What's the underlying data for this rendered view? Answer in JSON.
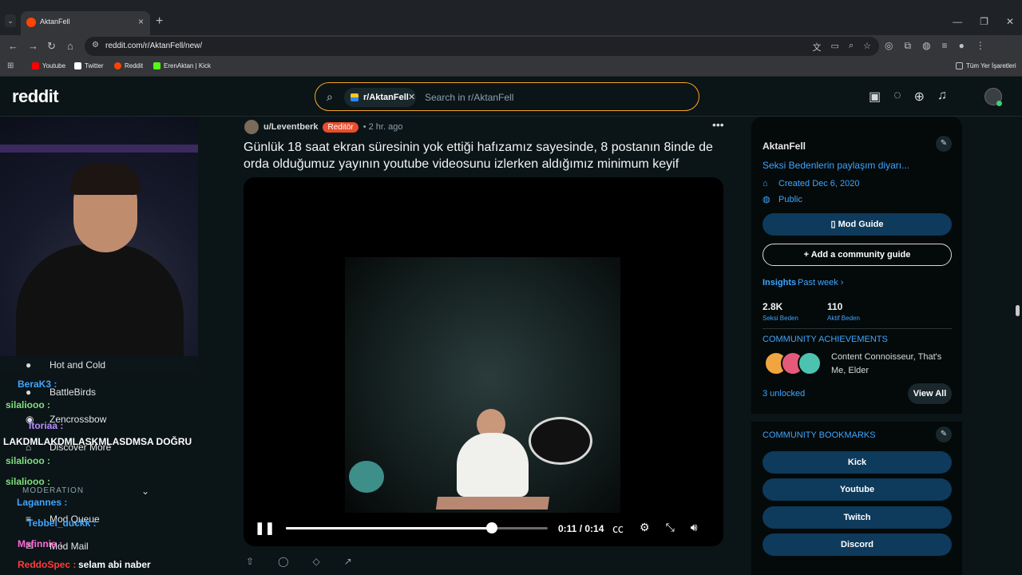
{
  "browser": {
    "tab_title": "AktanFell",
    "url": "reddit.com/r/AktanFell/new/",
    "bookmarks": [
      {
        "label": "Youtube",
        "color": "#ff0000"
      },
      {
        "label": "Twitter",
        "color": "#ffffff"
      },
      {
        "label": "Reddit",
        "color": "#ff4500"
      },
      {
        "label": "ErenAktan | Kick",
        "color": "#53fc18"
      }
    ],
    "all_bookmarks": "Tüm Yer İşaretleri"
  },
  "header": {
    "logo": "reddit",
    "search_chip": "r/AktanFell",
    "search_placeholder": "Search in r/AktanFell"
  },
  "overlay": {
    "menu": [
      "Hot and Cold",
      "BattleBirds",
      "Zencrossbow",
      "Discover More",
      "MODERATION",
      "Mod Queue",
      "Mod Mail"
    ],
    "chat": [
      {
        "user": "BeraK3 :",
        "msg": "",
        "color": "#3ea6ff"
      },
      {
        "user": "silaliooo :",
        "msg": "",
        "color": "#7fe07f"
      },
      {
        "user": "Itoriaa :",
        "msg": "",
        "color": "#b88cff"
      },
      {
        "user": "",
        "msg": "LAKDMLAKDMLASKMLASDMSA DOĞRU",
        "color": "#ffffff"
      },
      {
        "user": "silaliooo :",
        "msg": "",
        "color": "#7fe07f"
      },
      {
        "user": "silaliooo :",
        "msg": "",
        "color": "#7fe07f"
      },
      {
        "user": "Lagannes :",
        "msg": "",
        "color": "#3ea6ff"
      },
      {
        "user": "Tebbel_duckk :",
        "msg": "",
        "color": "#3ea6ff"
      },
      {
        "user": "Msfinnie :",
        "msg": "",
        "color": "#ff6ad5"
      },
      {
        "user": "ReddoSpec :",
        "msg": "selam abi naber",
        "color": "#ff3b3b"
      }
    ]
  },
  "post": {
    "author": "u/Leventberk",
    "flair": "Reditör",
    "time": "• 2 hr. ago",
    "title": "Günlük 18 saat ekran süresinin yok ettiği hafızamız sayesinde, 8 postanın 8inde de orda olduğumuz yayının youtube videosunu izlerken aldığımız minimum keyif",
    "video": {
      "current_time": "0:11",
      "duration": "0:14",
      "time_display": "0:11 / 0:14",
      "progress": 0.7857
    }
  },
  "sidebar": {
    "community_name": "AktanFell",
    "description": "Seksi Bedenlerin paylaşım diyarı...",
    "created": "Created Dec 6, 2020",
    "visibility": "Public",
    "mod_guide": "Mod Guide",
    "add_guide": "Add a community guide",
    "insights": "Insights",
    "past_week": "Past week ›",
    "stats": [
      {
        "value": "2.8K",
        "label": "Seksi Beden"
      },
      {
        "value": "110",
        "label": "Aktif Beden"
      }
    ],
    "achievements_title": "COMMUNITY ACHIEVEMENTS",
    "achievements": "Content Connoisseur, That's Me, Elder",
    "unlocked": "3 unlocked",
    "view_all": "View All",
    "bookmarks_title": "COMMUNITY BOOKMARKS",
    "bookmarks": [
      "Kick",
      "Youtube",
      "Twitch",
      "Discord"
    ]
  },
  "colors": {
    "accent_blue": "#3ea6ff",
    "search_border": "#f5a623",
    "flair": "#e84d2c",
    "page_bg": "#0b1416"
  }
}
